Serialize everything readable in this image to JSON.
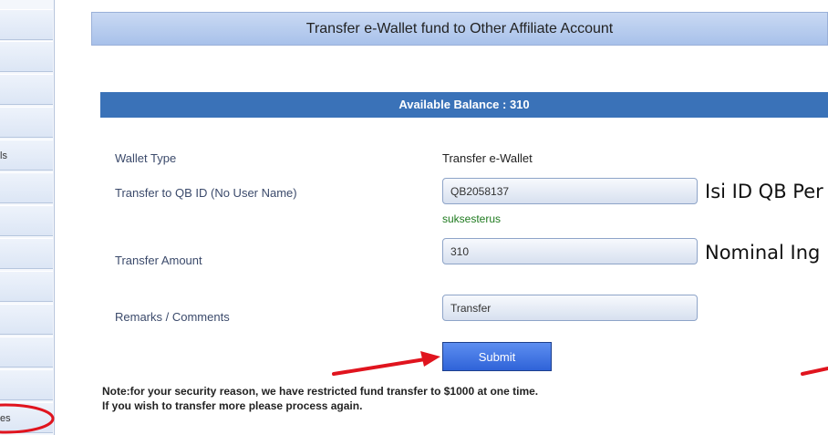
{
  "sidebar": {
    "items": [
      {
        "label": ""
      },
      {
        "label": ""
      },
      {
        "label": ""
      },
      {
        "label": ""
      },
      {
        "label": "ls"
      },
      {
        "label": ""
      },
      {
        "label": ""
      },
      {
        "label": ""
      },
      {
        "label": ""
      },
      {
        "label": ""
      },
      {
        "label": ""
      },
      {
        "label": ""
      },
      {
        "label": "es"
      }
    ]
  },
  "header": {
    "title": "Transfer e-Wallet fund to Other Affiliate Account"
  },
  "balance": {
    "text": "Available Balance : 310"
  },
  "form": {
    "wallet_type_label": "Wallet Type",
    "wallet_type_value": "Transfer e-Wallet",
    "transfer_to_label": "Transfer to QB ID (No User Name)",
    "transfer_to_value": "QB2058137",
    "status_text": "suksesterus",
    "amount_label": "Transfer Amount",
    "amount_value": "310",
    "remarks_label": "Remarks / Comments",
    "remarks_value": "Transfer",
    "submit_label": "Submit"
  },
  "annotations": {
    "id_hint": "Isi ID QB Per",
    "amount_hint": "Nominal Ing"
  },
  "note": {
    "line1": "Note:for your security reason, we have restricted fund transfer to $1000 at one time.",
    "line2": "If you wish to transfer more please process again."
  },
  "colors": {
    "accent": "#3a72b8",
    "annotation_red": "#e0141e",
    "status_green": "#1f7a1f"
  }
}
